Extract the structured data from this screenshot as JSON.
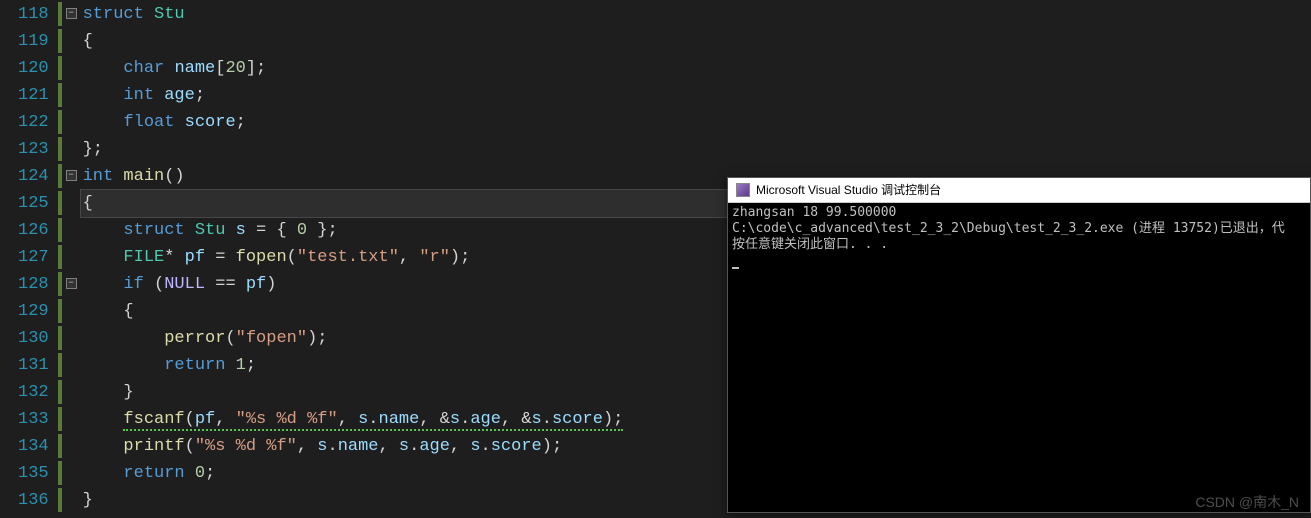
{
  "gutter": {
    "start": 118,
    "end": 136
  },
  "fold_markers": [
    {
      "line": 118,
      "symbol": "−"
    },
    {
      "line": 124,
      "symbol": "−"
    },
    {
      "line": 128,
      "symbol": "−"
    }
  ],
  "indicators": [
    118,
    119,
    120,
    121,
    122,
    123,
    124,
    125,
    126,
    127,
    128,
    129,
    130,
    131,
    132,
    133,
    134,
    135,
    136
  ],
  "code": {
    "l118": {
      "kw1": "struct",
      "tp": "Stu"
    },
    "l119": {
      "br": "{"
    },
    "l120": {
      "kw": "char",
      "id": "name",
      "arr": "[",
      "sz": "20",
      "arr2": "];"
    },
    "l121": {
      "kw": "int",
      "id": "age",
      "semi": ";"
    },
    "l122": {
      "kw": "float",
      "id": "score",
      "semi": ";"
    },
    "l123": {
      "br": "};"
    },
    "l124": {
      "kw": "int",
      "fn": "main",
      "par": "()"
    },
    "l125": {
      "br": "{"
    },
    "l126": {
      "kw": "struct",
      "tp": "Stu",
      "id": "s",
      "eq": " = { ",
      "num": "0",
      "end": " };"
    },
    "l127": {
      "tp": "FILE",
      "ptr": "* ",
      "id": "pf",
      "eq": " = ",
      "fn": "fopen",
      "p1": "(",
      "s1": "\"test.txt\"",
      "comma": ", ",
      "s2": "\"r\"",
      "p2": ");"
    },
    "l128": {
      "kw": "if",
      "p1": " (",
      "mc": "NULL",
      "eq": " == ",
      "id": "pf",
      "p2": ")"
    },
    "l129": {
      "br": "{"
    },
    "l130": {
      "fn": "perror",
      "p1": "(",
      "s": "\"fopen\"",
      "p2": ");"
    },
    "l131": {
      "kw": "return",
      "sp": " ",
      "num": "1",
      "semi": ";"
    },
    "l132": {
      "br": "}"
    },
    "l133": {
      "fn": "fscanf",
      "p1": "(",
      "a1": "pf",
      "c1": ", ",
      "s": "\"%s %d %f\"",
      "c2": ", ",
      "a2": "s",
      "d1": ".",
      "m1": "name",
      "c3": ", &",
      "a3": "s",
      "d2": ".",
      "m2": "age",
      "c4": ", &",
      "a4": "s",
      "d3": ".",
      "m3": "score",
      "p2": ");"
    },
    "l134": {
      "fn": "printf",
      "p1": "(",
      "s": "\"%s %d %f\"",
      "c1": ", ",
      "a1": "s",
      "d1": ".",
      "m1": "name",
      "c2": ", ",
      "a2": "s",
      "d2": ".",
      "m2": "age",
      "c3": ", ",
      "a3": "s",
      "d3": ".",
      "m3": "score",
      "p2": ");"
    },
    "l135": {
      "kw": "return",
      "sp": " ",
      "num": "0",
      "semi": ";"
    },
    "l136": {
      "br": "}"
    }
  },
  "console": {
    "title": "Microsoft Visual Studio 调试控制台",
    "line1": "zhangsan 18 99.500000",
    "line2": "C:\\code\\c_advanced\\test_2_3_2\\Debug\\test_2_3_2.exe (进程 13752)已退出，代",
    "line3": "按任意键关闭此窗口. . ."
  },
  "watermark": "CSDN @南木_N"
}
